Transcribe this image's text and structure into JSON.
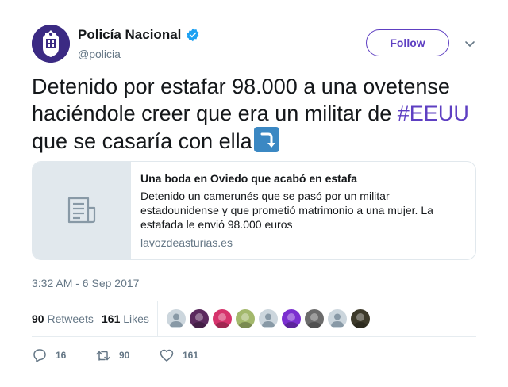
{
  "author": {
    "display_name": "Policía Nacional",
    "handle": "@policia",
    "avatar_icon": "police-badge-icon",
    "verified_icon": "verified-badge-icon",
    "verified_color": "#1da1f2"
  },
  "header": {
    "follow_label": "Follow",
    "menu_icon": "chevron-down-icon"
  },
  "tweet": {
    "text_part1": "Detenido por estafar 98.000 a una ovetense haciéndole creer que era un militar de ",
    "hashtag": "#EEUU",
    "text_part2": " que se casaría con ella",
    "emoji_icon": "arrow-curving-down-icon"
  },
  "card": {
    "thumb_icon": "article-icon",
    "title": "Una boda en Oviedo que acabó en estafa",
    "description": "Detenido un camerunés que se pasó por un militar estadounidense y que prometió matrimonio a una mujer. La estafada le envió 98.000 euros",
    "domain": "lavozdeasturias.es"
  },
  "timestamp": "3:32 AM - 6 Sep 2017",
  "stats": {
    "retweets_count": "90",
    "retweets_label": "Retweets",
    "likes_count": "161",
    "likes_label": "Likes",
    "likers": [
      {
        "icon": "default-avatar-icon",
        "color": "#ccd6dd"
      },
      {
        "icon": "user-avatar-icon",
        "color": "#5b2a5e"
      },
      {
        "icon": "user-avatar-icon",
        "color": "#d6336c"
      },
      {
        "icon": "user-avatar-icon",
        "color": "#a3b86c"
      },
      {
        "icon": "default-avatar-icon",
        "color": "#ccd6dd"
      },
      {
        "icon": "user-avatar-icon",
        "color": "#7b2fd0"
      },
      {
        "icon": "user-avatar-icon",
        "color": "#6b6b6b"
      },
      {
        "icon": "default-avatar-icon",
        "color": "#ccd6dd"
      },
      {
        "icon": "user-avatar-icon",
        "color": "#3d3a2a"
      }
    ]
  },
  "actions": {
    "reply_icon": "reply-icon",
    "reply_count": "16",
    "retweet_icon": "retweet-icon",
    "retweet_count": "90",
    "like_icon": "heart-icon",
    "like_count": "161"
  },
  "colors": {
    "accent": "#5e3fc2",
    "secondary_text": "#657786",
    "border": "#e1e8ed"
  }
}
